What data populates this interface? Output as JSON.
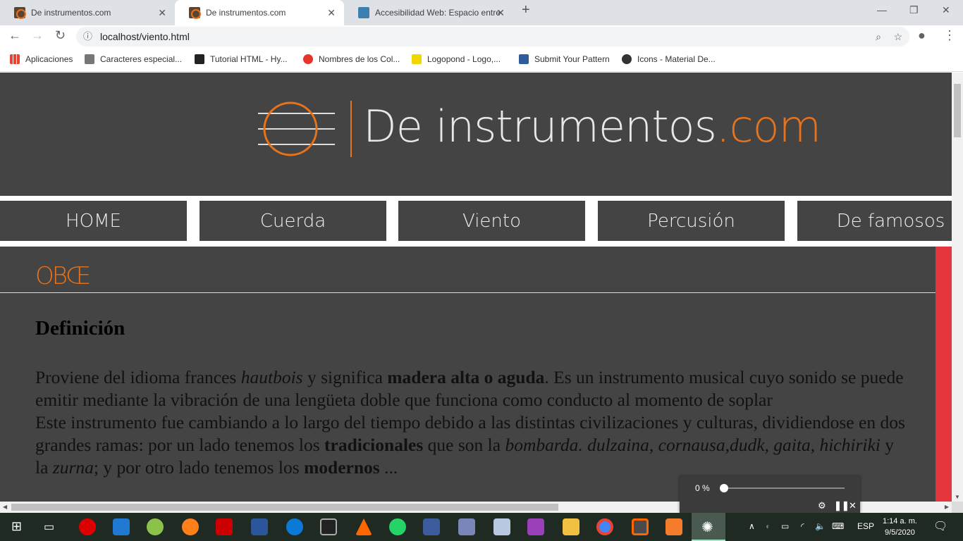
{
  "browser": {
    "tabs": [
      {
        "title": "De instrumentos.com",
        "active": false
      },
      {
        "title": "De instrumentos.com",
        "active": true
      },
      {
        "title": "Accesibilidad Web: Espacio entre",
        "active": false
      }
    ],
    "url": "localhost/viento.html",
    "bookmarks": [
      {
        "label": "Aplicaciones",
        "color": "#4285f4"
      },
      {
        "label": "Caracteres especial...",
        "color": "#777777"
      },
      {
        "label": "Tutorial HTML - Hy...",
        "color": "#222222"
      },
      {
        "label": "Nombres de los Col...",
        "color": "#e8332a"
      },
      {
        "label": "Logopond - Logo,...",
        "color": "#f2d600"
      },
      {
        "label": "Submit Your Pattern",
        "color": "#2f5d9c"
      },
      {
        "label": "Icons - Material De...",
        "color": "#333333"
      }
    ]
  },
  "site": {
    "logo": {
      "name": "De instrumentos",
      "suffix": ".com",
      "accent": "#e8731a"
    },
    "nav": [
      "HOME",
      "Cuerda",
      "Viento",
      "Percusión",
      "De famosos"
    ],
    "page_title": "OBŒ",
    "section_heading": "Definición",
    "paragraph": [
      {
        "t": "Proviene del idioma frances "
      },
      {
        "t": "hautbois",
        "s": "i"
      },
      {
        "t": " y significa "
      },
      {
        "t": "madera alta o aguda",
        "s": "b"
      },
      {
        "t": ". Es un instrumento musical cuyo sonido se puede emitir mediante la vibración de una lengüeta doble que funciona como conducto al momento de soplar"
      },
      {
        "br": true
      },
      {
        "t": "Este instrumento fue cambiando a lo largo del tiempo debido a las distintas civilizaciones y culturas, dividiendose en dos grandes ramas: por un lado tenemos los "
      },
      {
        "t": "tradicionales",
        "s": "b"
      },
      {
        "t": " que son la "
      },
      {
        "t": "bombarda. dulzaina, cornausa,dudk, gaita, hichiriki",
        "s": "i"
      },
      {
        "t": " y la "
      },
      {
        "t": "zurna",
        "s": "i"
      },
      {
        "t": "; y por otro lado tenemos los "
      },
      {
        "t": "modernos",
        "s": "b"
      },
      {
        "t": " ..."
      }
    ]
  },
  "reader_widget": {
    "progress": "0 %",
    "progress_value": 0
  },
  "taskbar": {
    "language": "ESP",
    "time": "1:14 a. m.",
    "date": "9/5/2020"
  }
}
